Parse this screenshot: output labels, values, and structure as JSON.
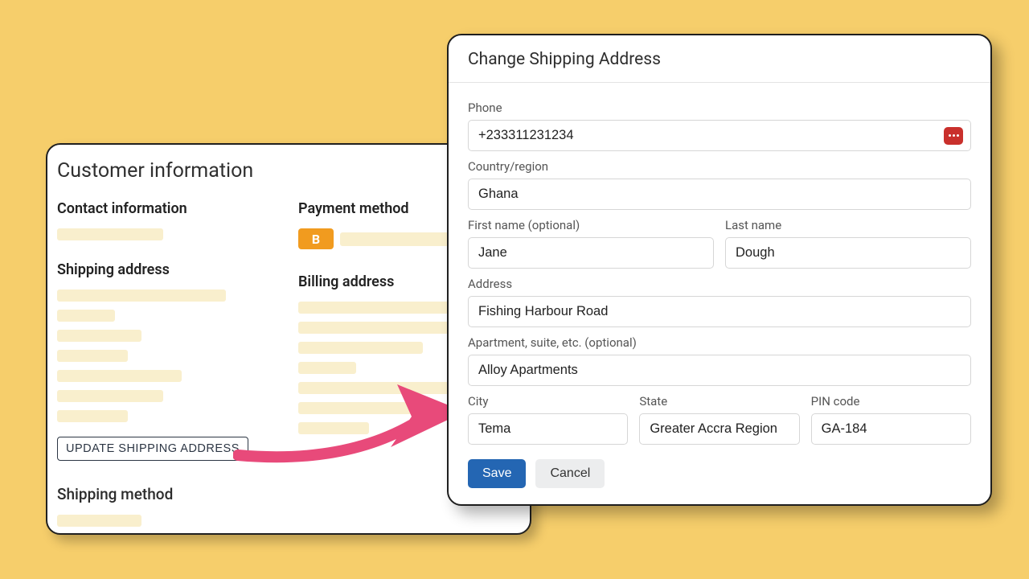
{
  "customer_panel": {
    "title": "Customer information",
    "contact_heading": "Contact information",
    "payment_heading": "Payment method",
    "payment_badge": "B",
    "shipping_heading": "Shipping address",
    "billing_heading": "Billing address",
    "update_button": "UPDATE SHIPPING ADDRESS",
    "shipping_method_heading": "Shipping method"
  },
  "modal": {
    "title": "Change Shipping Address",
    "labels": {
      "phone": "Phone",
      "country": "Country/region",
      "first_name": "First name (optional)",
      "last_name": "Last name",
      "address": "Address",
      "apartment": "Apartment, suite, etc. (optional)",
      "city": "City",
      "state": "State",
      "pin": "PIN code"
    },
    "values": {
      "phone": "+233311231234",
      "country": "Ghana",
      "first_name": "Jane",
      "last_name": "Dough",
      "address": "Fishing Harbour Road",
      "apartment": "Alloy Apartments",
      "city": "Tema",
      "state": "Greater Accra Region",
      "pin": "GA-184"
    },
    "actions": {
      "save": "Save",
      "cancel": "Cancel"
    }
  }
}
